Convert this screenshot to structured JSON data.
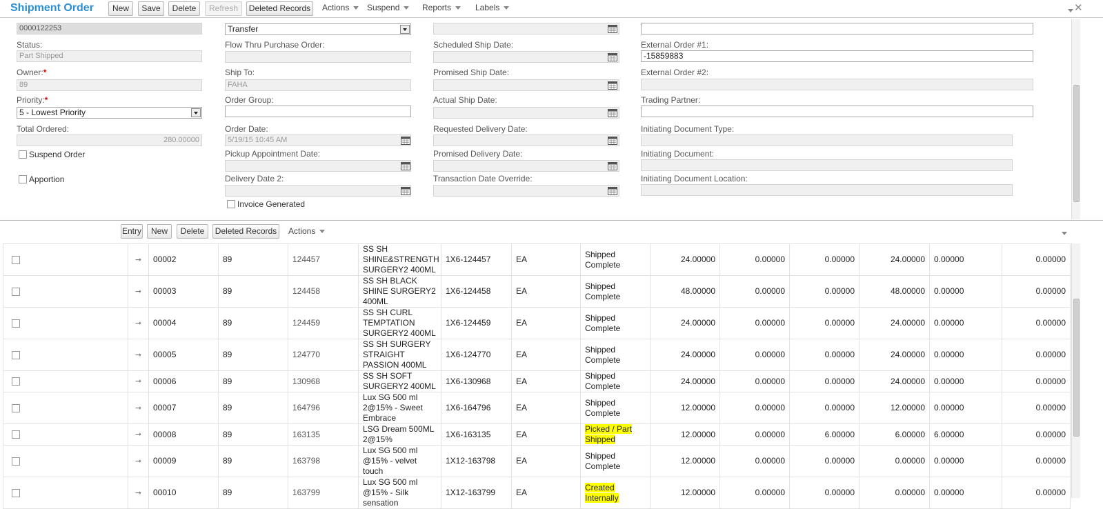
{
  "header": {
    "title": "Shipment Order",
    "buttons": {
      "new": "New",
      "save": "Save",
      "delete": "Delete",
      "refresh": "Refresh",
      "deleted_records": "Deleted Records"
    },
    "menus": {
      "actions": "Actions",
      "suspend": "Suspend",
      "reports": "Reports",
      "labels": "Labels"
    }
  },
  "form": {
    "order_number": "0000122253",
    "status_label": "Status:",
    "status_value": "Part Shipped",
    "owner_label": "Owner:",
    "owner_value": "89",
    "priority_label": "Priority:",
    "priority_value": "5 - Lowest Priority",
    "total_ordered_label": "Total Ordered:",
    "total_ordered_value": "280.00000",
    "suspend_label": "Suspend Order",
    "apportion_label": "Apportion",
    "order_type_value": "Transfer",
    "flow_thru_label": "Flow Thru Purchase Order:",
    "flow_thru_value": "",
    "ship_to_label": "Ship To:",
    "ship_to_value": "FAHA",
    "order_group_label": "Order Group:",
    "order_group_value": "",
    "order_date_label": "Order Date:",
    "order_date_value": "5/19/15 10:45 AM",
    "pickup_label": "Pickup Appointment Date:",
    "delivery2_label": "Delivery Date 2:",
    "invoice_label": "Invoice Generated",
    "scheduled_label": "Scheduled Ship Date:",
    "promised_ship_label": "Promised Ship Date:",
    "actual_ship_label": "Actual Ship Date:",
    "requested_delivery_label": "Requested Delivery Date:",
    "promised_delivery_label": "Promised Delivery Date:",
    "transaction_label": "Transaction Date Override:",
    "ext1_label": "External Order #1:",
    "ext1_value": "-15859883",
    "ext2_label": "External Order #2:",
    "trading_label": "Trading Partner:",
    "init_type_label": "Initiating Document Type:",
    "init_doc_label": "Initiating Document:",
    "init_loc_label": "Initiating Document Location:"
  },
  "grid_toolbar": {
    "entry": "Entry",
    "new": "New",
    "delete": "Delete",
    "deleted_records": "Deleted Records",
    "actions": "Actions"
  },
  "rows": [
    {
      "line": "00002",
      "owner": "89",
      "item": "124457",
      "desc": "SS SH SHINE&STRENGTH SURGERY2 400ML",
      "pack": "1X6-124457",
      "uom": "EA",
      "status": "Shipped Complete",
      "hl": false,
      "c1": "24.00000",
      "c2": "0.00000",
      "c3": "0.00000",
      "c4": "24.00000",
      "c5": "0.00000",
      "c6": "0.00000"
    },
    {
      "line": "00003",
      "owner": "89",
      "item": "124458",
      "desc": "SS SH BLACK SHINE SURGERY2 400ML",
      "pack": "1X6-124458",
      "uom": "EA",
      "status": "Shipped Complete",
      "hl": false,
      "c1": "48.00000",
      "c2": "0.00000",
      "c3": "0.00000",
      "c4": "48.00000",
      "c5": "0.00000",
      "c6": "0.00000"
    },
    {
      "line": "00004",
      "owner": "89",
      "item": "124459",
      "desc": "SS SH CURL TEMPTATION SURGERY2 400ML",
      "pack": "1X6-124459",
      "uom": "EA",
      "status": "Shipped Complete",
      "hl": false,
      "c1": "24.00000",
      "c2": "0.00000",
      "c3": "0.00000",
      "c4": "24.00000",
      "c5": "0.00000",
      "c6": "0.00000"
    },
    {
      "line": "00005",
      "owner": "89",
      "item": "124770",
      "desc": "SS SH SURGERY STRAIGHT PASSION 400ML",
      "pack": "1X6-124770",
      "uom": "EA",
      "status": "Shipped Complete",
      "hl": false,
      "c1": "24.00000",
      "c2": "0.00000",
      "c3": "0.00000",
      "c4": "24.00000",
      "c5": "0.00000",
      "c6": "0.00000"
    },
    {
      "line": "00006",
      "owner": "89",
      "item": "130968",
      "desc": "SS SH SOFT SURGERY2 400ML",
      "pack": "1X6-130968",
      "uom": "EA",
      "status": "Shipped Complete",
      "hl": false,
      "c1": "24.00000",
      "c2": "0.00000",
      "c3": "0.00000",
      "c4": "24.00000",
      "c5": "0.00000",
      "c6": "0.00000"
    },
    {
      "line": "00007",
      "owner": "89",
      "item": "164796",
      "desc": "Lux SG 500 ml 2@15% - Sweet Embrace",
      "pack": "1X6-164796",
      "uom": "EA",
      "status": "Shipped Complete",
      "hl": false,
      "c1": "12.00000",
      "c2": "0.00000",
      "c3": "0.00000",
      "c4": "12.00000",
      "c5": "0.00000",
      "c6": "0.00000"
    },
    {
      "line": "00008",
      "owner": "89",
      "item": "163135",
      "desc": "LSG Dream 500ML 2@15%",
      "pack": "1X6-163135",
      "uom": "EA",
      "status": "Picked / Part Shipped",
      "hl": true,
      "c1": "12.00000",
      "c2": "0.00000",
      "c3": "6.00000",
      "c4": "6.00000",
      "c5": "6.00000",
      "c6": "0.00000"
    },
    {
      "line": "00009",
      "owner": "89",
      "item": "163798",
      "desc": "Lux SG 500 ml @15% - velvet touch",
      "pack": "1X12-163798",
      "uom": "EA",
      "status": "Shipped Complete",
      "hl": false,
      "c1": "12.00000",
      "c2": "0.00000",
      "c3": "0.00000",
      "c4": "0.00000",
      "c5": "0.00000",
      "c6": "0.00000"
    },
    {
      "line": "00010",
      "owner": "89",
      "item": "163799",
      "desc": "Lux SG 500 ml @15% - Silk sensation",
      "pack": "1X12-163799",
      "uom": "EA",
      "status": "Created Internally",
      "hl": true,
      "c1": "12.00000",
      "c2": "0.00000",
      "c3": "0.00000",
      "c4": "0.00000",
      "c5": "0.00000",
      "c6": "0.00000"
    }
  ]
}
